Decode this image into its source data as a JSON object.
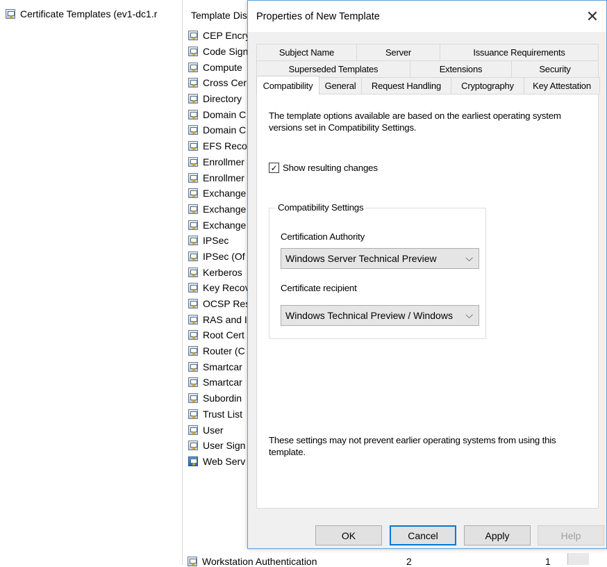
{
  "tree": {
    "root_label": "Certificate Templates (ev1-dc1.r"
  },
  "list": {
    "header_label": "Template Dis",
    "rows": [
      "CEP Encry",
      "Code Signi",
      "Compute",
      "Cross Cer",
      "Directory",
      "Domain C",
      "Domain C",
      "EFS Recov",
      "Enrollmer",
      "Enrollmer",
      "Exchange",
      "Exchange",
      "Exchange",
      "IPSec",
      "IPSec (Of",
      "Kerberos",
      "Key Recov",
      "OCSP Res",
      "RAS and I",
      "Root Cert",
      "Router (C",
      "Smartcar",
      "Smartcar",
      "Subordin",
      "Trust List",
      "User",
      "User Sign",
      "Web Serv"
    ],
    "last_row": {
      "name": "Workstation Authentication",
      "col2": "2",
      "col3": "1"
    }
  },
  "dialog": {
    "title": "Properties of New Template",
    "close_glyph": "✕",
    "tabs_row1": [
      "Subject Name",
      "Server",
      "Issuance Requirements"
    ],
    "tabs_row2": [
      "Superseded Templates",
      "Extensions",
      "Security"
    ],
    "tabs_row3": [
      "Compatibility",
      "General",
      "Request Handling",
      "Cryptography",
      "Key Attestation"
    ],
    "active_tab": "Compatibility",
    "info_text": "The template options available are based on the earliest operating system versions set in Compatibility Settings.",
    "show_changes": {
      "label": "Show resulting changes",
      "checked": true
    },
    "compat_group": {
      "legend": "Compatibility Settings",
      "ca_label": "Certification Authority",
      "ca_value": "Windows Server Technical Preview",
      "recipient_label": "Certificate recipient",
      "recipient_value": "Windows Technical Preview / Windows"
    },
    "bottom_note": "These settings may not prevent earlier operating systems from using this template.",
    "buttons": {
      "ok": "OK",
      "cancel": "Cancel",
      "apply": "Apply",
      "help": "Help"
    }
  },
  "icons": {
    "template": "certificate-template-icon",
    "checkmark": "✓",
    "chevron": "⌵"
  }
}
